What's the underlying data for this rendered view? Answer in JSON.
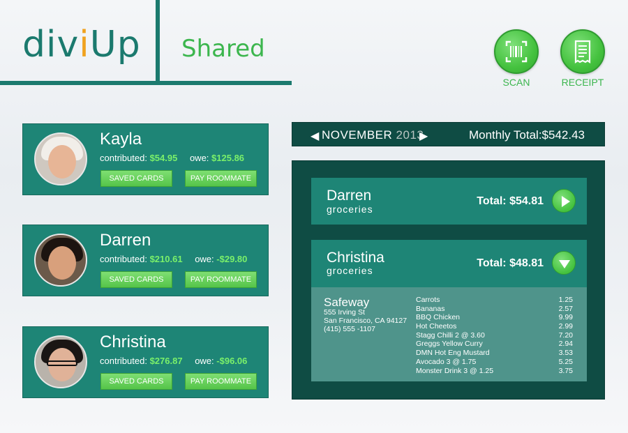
{
  "app": {
    "logo_part1": "div",
    "logo_accent": "i",
    "logo_part2": "Up",
    "page_title": "Shared",
    "accent_color": "#f0a21e",
    "brand_color": "#1b7a6e"
  },
  "actions": {
    "scan_label": "SCAN",
    "scan_icon": "barcode-scan-icon",
    "receipt_label": "RECEIPT",
    "receipt_icon": "receipt-icon"
  },
  "roommates": [
    {
      "name": "Kayla",
      "contributed_label": "contributed:",
      "contributed": "$54.95",
      "owe_label": "owe:",
      "owe": "$125.86",
      "saved_cards_label": "SAVED CARDS",
      "pay_label": "PAY ROOMMATE"
    },
    {
      "name": "Darren",
      "contributed_label": "contributed:",
      "contributed": "$210.61",
      "owe_label": "owe:",
      "owe": "-$29.80",
      "saved_cards_label": "SAVED CARDS",
      "pay_label": "PAY ROOMMATE"
    },
    {
      "name": "Christina",
      "contributed_label": "contributed:",
      "contributed": "$276.87",
      "owe_label": "owe:",
      "owe": "-$96.06",
      "saved_cards_label": "SAVED CARDS",
      "pay_label": "PAY ROOMMATE"
    }
  ],
  "period": {
    "prev_symbol": "◀",
    "month": "NOVEMBER",
    "year": "2013",
    "next_symbol": "▶",
    "monthly_total_label": "Monthly Total:",
    "monthly_total": "$542.43"
  },
  "expenses": [
    {
      "name": "Darren",
      "category": "groceries",
      "total_label": "Total:",
      "total": "$54.81",
      "state": "collapsed"
    },
    {
      "name": "Christina",
      "category": "groceries",
      "total_label": "Total:",
      "total": "$48.81",
      "state": "expanded",
      "receipt": {
        "store": "Safeway",
        "address_line1": "555 Irving St",
        "address_line2": "San Francisco, CA 94127",
        "phone": "(415) 555 -1107",
        "items": [
          {
            "name": "Carrots",
            "price": "1.25"
          },
          {
            "name": "Bananas",
            "price": "2.57"
          },
          {
            "name": "BBQ Chicken",
            "price": "9.99"
          },
          {
            "name": "Hot Cheetos",
            "price": "2.99"
          },
          {
            "name": "Stagg Chilli   2 @ 3.60",
            "price": "7.20"
          },
          {
            "name": "Greggs Yellow Curry",
            "price": "2.94"
          },
          {
            "name": "DMN Hot Eng Mustard",
            "price": "3.53"
          },
          {
            "name": "Avocado   3 @ 1.75",
            "price": "5.25"
          },
          {
            "name": "Monster Drink   3 @ 1.25",
            "price": "3.75"
          }
        ]
      }
    }
  ]
}
